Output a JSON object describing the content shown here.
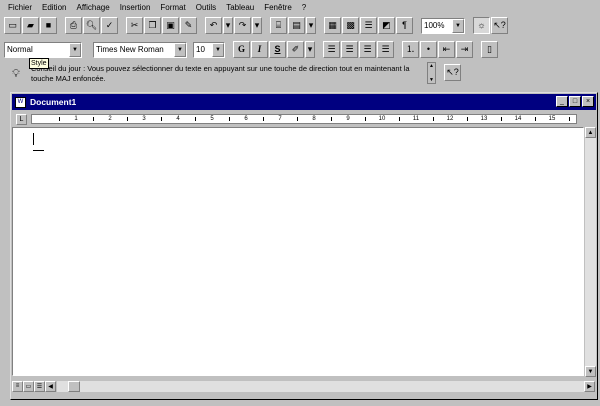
{
  "menu": [
    "Fichier",
    "Edition",
    "Affichage",
    "Insertion",
    "Format",
    "Outils",
    "Tableau",
    "Fenêtre",
    "?"
  ],
  "standard_toolbar": {
    "zoom": "100%",
    "undo_icon": "undo-icon",
    "redo_icon": "redo-icon"
  },
  "format_toolbar": {
    "style": "Normal",
    "font": "Times New Roman",
    "size": "10",
    "bold_label": "G",
    "italic_label": "I",
    "underline_label": "S"
  },
  "tip": {
    "text": "Conseil du jour : Vous pouvez sélectionner du texte en appuyant sur une touche de direction tout en maintenant la touche MAJ enfoncée.",
    "tooltip": "Style"
  },
  "document": {
    "title": "Document1"
  },
  "ruler": {
    "numbers": [
      "1",
      "2",
      "3",
      "4",
      "5",
      "6",
      "7",
      "8",
      "9",
      "10",
      "11",
      "12",
      "13",
      "14",
      "15"
    ]
  }
}
